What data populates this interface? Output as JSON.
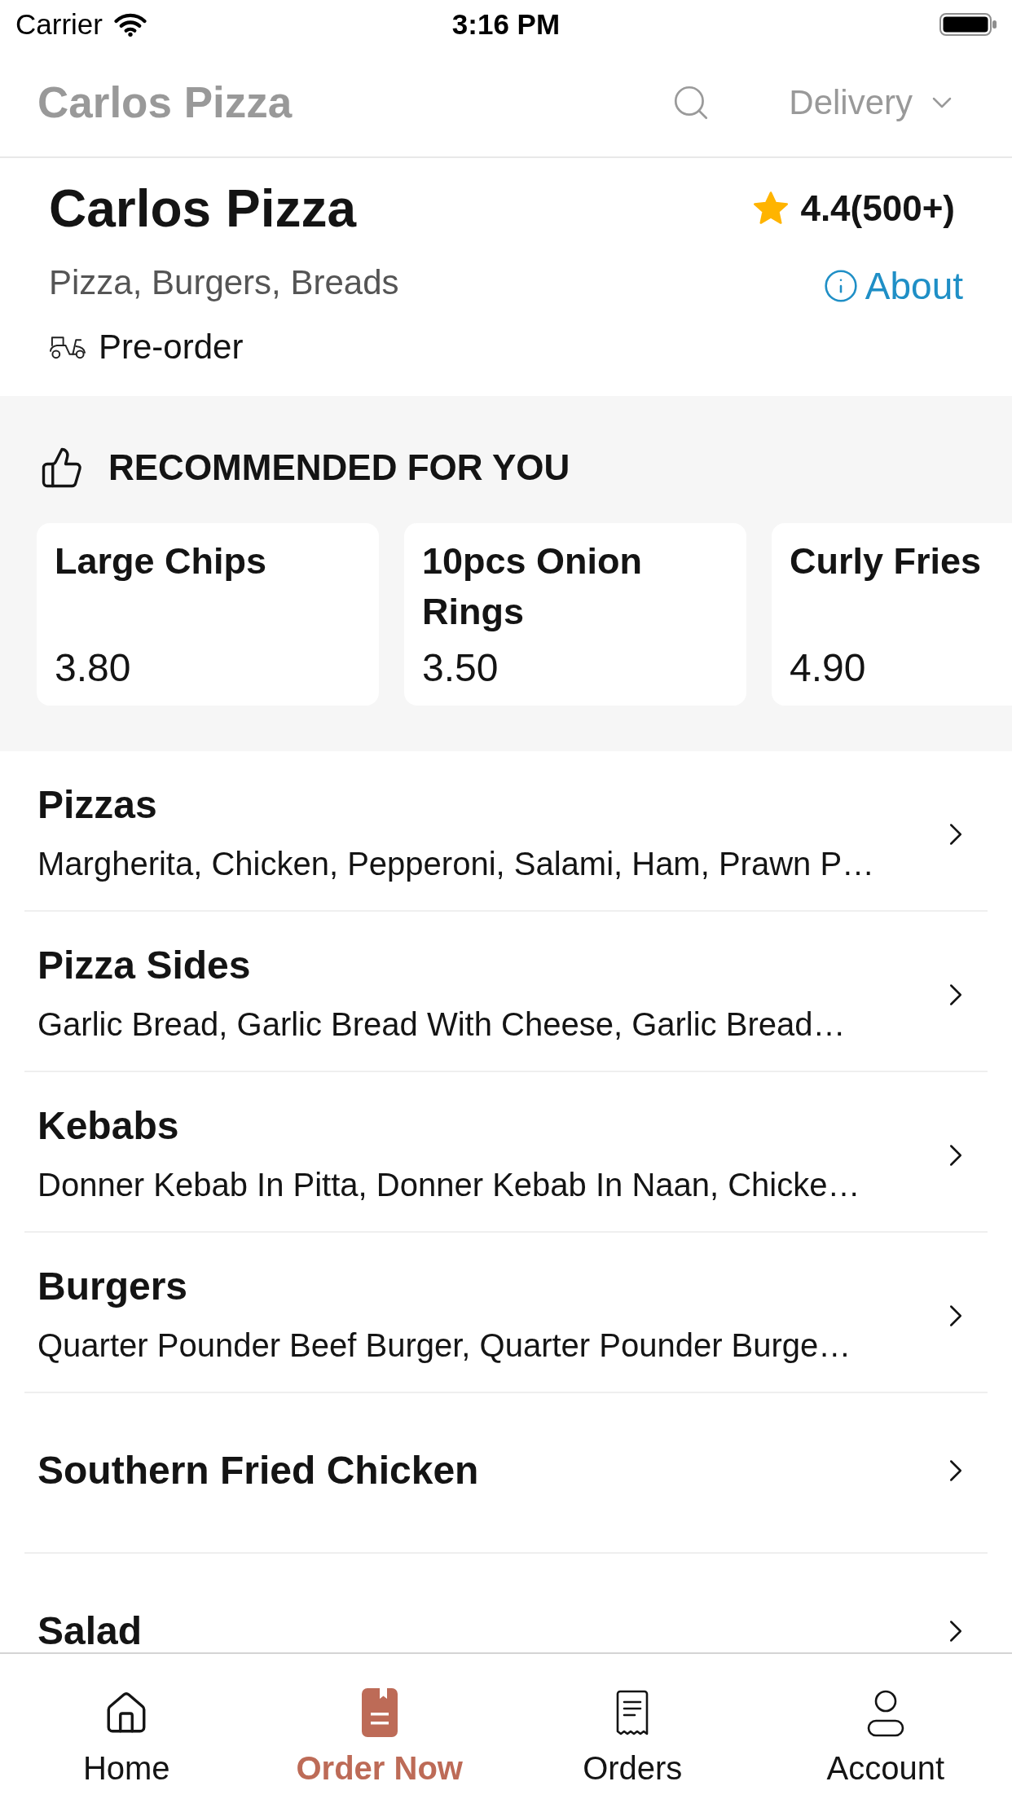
{
  "status_bar": {
    "carrier": "Carrier",
    "time": "3:16 PM"
  },
  "nav_bar": {
    "title": "Carlos Pizza",
    "order_mode": "Delivery"
  },
  "restaurant": {
    "name": "Carlos Pizza",
    "rating": "4.4(500+)",
    "cuisines": "Pizza, Burgers, Breads",
    "about_link": "About",
    "service": "Pre-order"
  },
  "recommended": {
    "heading": "RECOMMENDED FOR YOU",
    "items": [
      {
        "name": "Large Chips",
        "price": "3.80"
      },
      {
        "name": "10pcs Onion Rings",
        "price": "3.50"
      },
      {
        "name": "Curly Fries",
        "price": "4.90"
      }
    ]
  },
  "categories": [
    {
      "name": "Pizzas",
      "items_preview": "Margherita, Chicken, Pepperoni, Salami, Ham, Prawn P…"
    },
    {
      "name": "Pizza Sides",
      "items_preview": "Garlic Bread, Garlic Bread With Cheese, Garlic Bread…"
    },
    {
      "name": "Kebabs",
      "items_preview": "Donner Kebab In Pitta, Donner Kebab In Naan, Chicke…"
    },
    {
      "name": "Burgers",
      "items_preview": "Quarter Pounder Beef Burger, Quarter Pounder Burge…"
    },
    {
      "name": "Southern Fried Chicken"
    },
    {
      "name": "Salad"
    }
  ],
  "tab_bar": [
    {
      "label": "Home",
      "selected": false
    },
    {
      "label": "Order Now",
      "selected": true
    },
    {
      "label": "Orders",
      "selected": false
    },
    {
      "label": "Account",
      "selected": false
    }
  ]
}
